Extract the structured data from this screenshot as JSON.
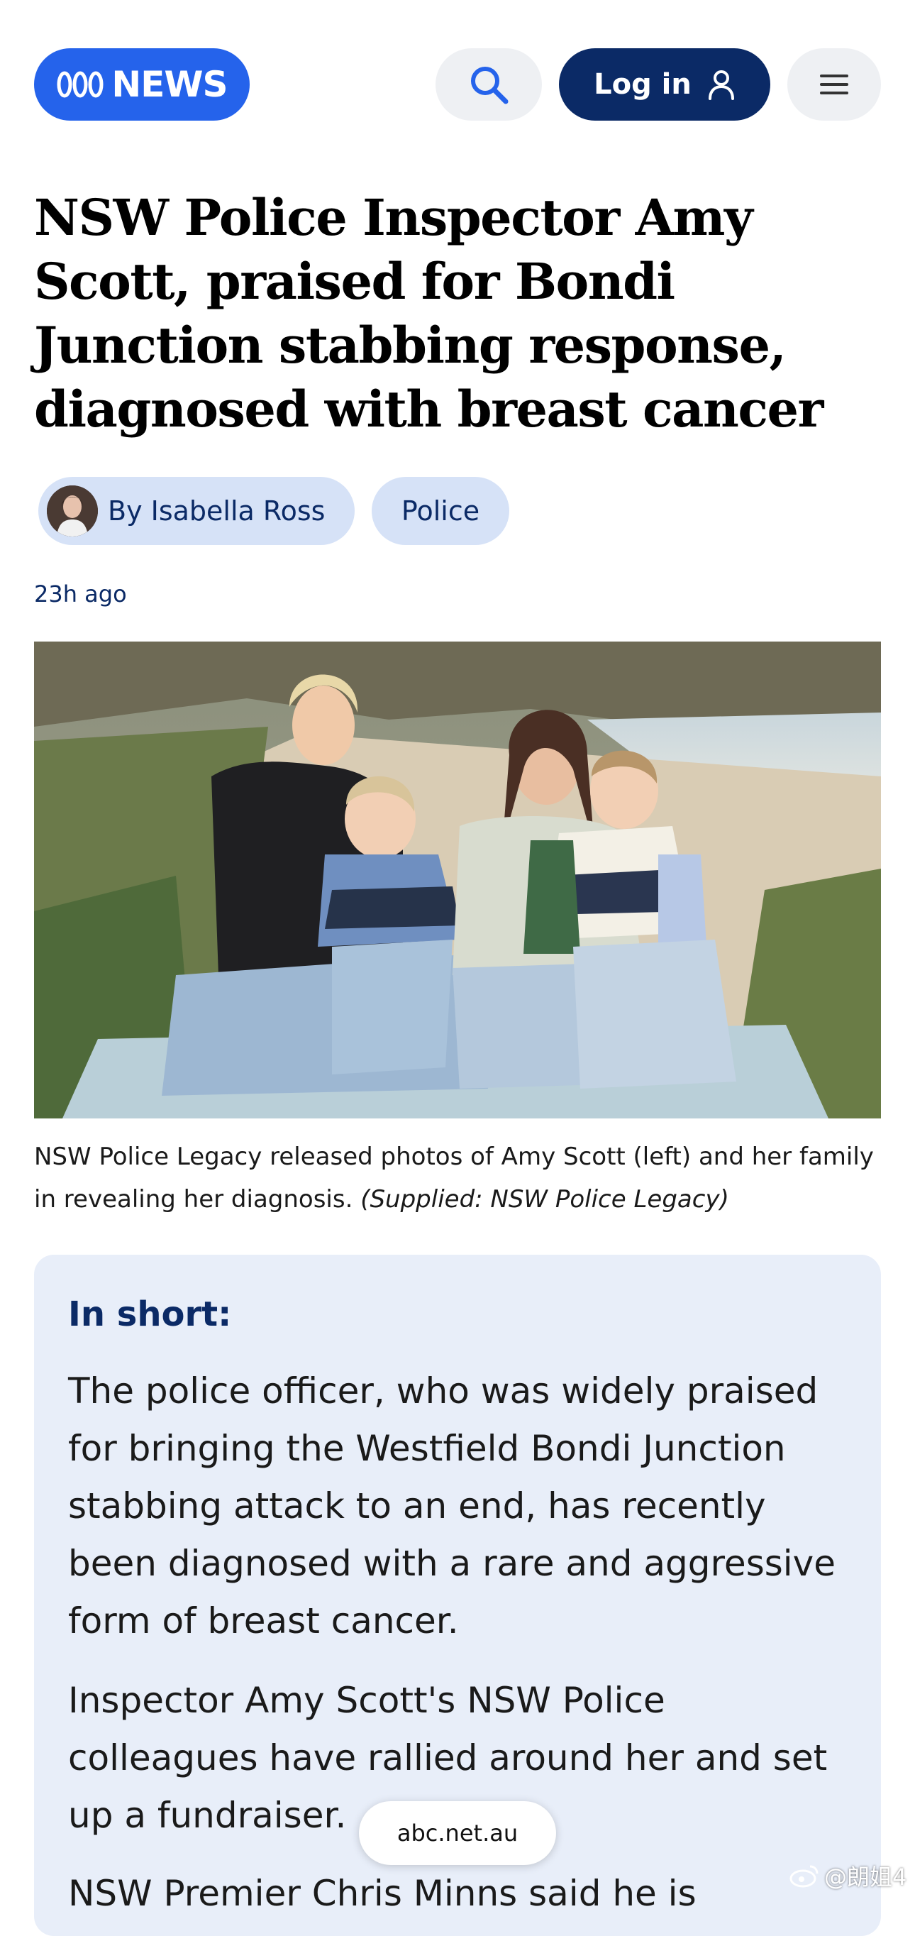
{
  "header": {
    "logo_text": "NEWS",
    "login_label": "Log in"
  },
  "article": {
    "headline": "NSW Police Inspector Amy Scott, praised for Bondi Junction stabbing response, diagnosed with breast cancer",
    "author_label": "By Isabella Ross",
    "topic_label": "Police",
    "timestamp": "23h ago",
    "caption_text": "NSW Police Legacy released photos of Amy Scott (left) and her family in revealing her diagnosis.",
    "caption_credit": "(Supplied: NSW Police Legacy)"
  },
  "in_short": {
    "heading": "In short:",
    "paragraphs": [
      "The police officer, who was widely praised for bringing the Westfield Bondi Junction stabbing attack to an end, has recently been diagnosed with a rare and aggressive form of breast cancer.",
      "Inspector Amy Scott's NSW Police colleagues have rallied around her and set up a fundraiser.",
      "NSW Premier Chris Minns said he is"
    ]
  },
  "browser": {
    "url": "abc.net.au"
  },
  "watermark": {
    "text": "@朗姐4"
  },
  "colors": {
    "logo_blue": "#2563eb",
    "navy": "#0b2a66",
    "chip_bg": "#d6e2f7",
    "short_bg": "#e8eef9",
    "button_grey": "#eef0f3"
  }
}
